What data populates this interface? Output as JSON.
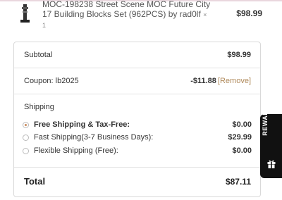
{
  "product": {
    "name": "MOC-198238 Street Scene MOC Future City 17 Building Blocks Set (962PCS) by rad0lf",
    "quantity": "× 1",
    "price": "$98.99",
    "thumbnail_icon": "lego-building-thumbnail"
  },
  "totals": {
    "subtotal_label": "Subtotal",
    "subtotal_value": "$98.99",
    "coupon_label": "Coupon: lb2025",
    "coupon_value": "-$11.88",
    "coupon_remove": "[Remove]",
    "shipping_heading": "Shipping",
    "shipping_options": [
      {
        "label": "Free Shipping & Tax-Free:",
        "price": "$0.00",
        "selected": true
      },
      {
        "label": "Fast Shipping(3-7 Business Days):",
        "price": "$29.99",
        "selected": false
      },
      {
        "label": "Flexible Shipping (Free):",
        "price": "$0.00",
        "selected": false
      }
    ],
    "total_label": "Total",
    "total_value": "$87.11"
  },
  "rewards": {
    "label": "REWARDS",
    "icon": "gift-icon"
  },
  "colors": {
    "accent": "#c8885a",
    "remove_link": "#b08a5b",
    "rewards_bg": "#111111"
  }
}
